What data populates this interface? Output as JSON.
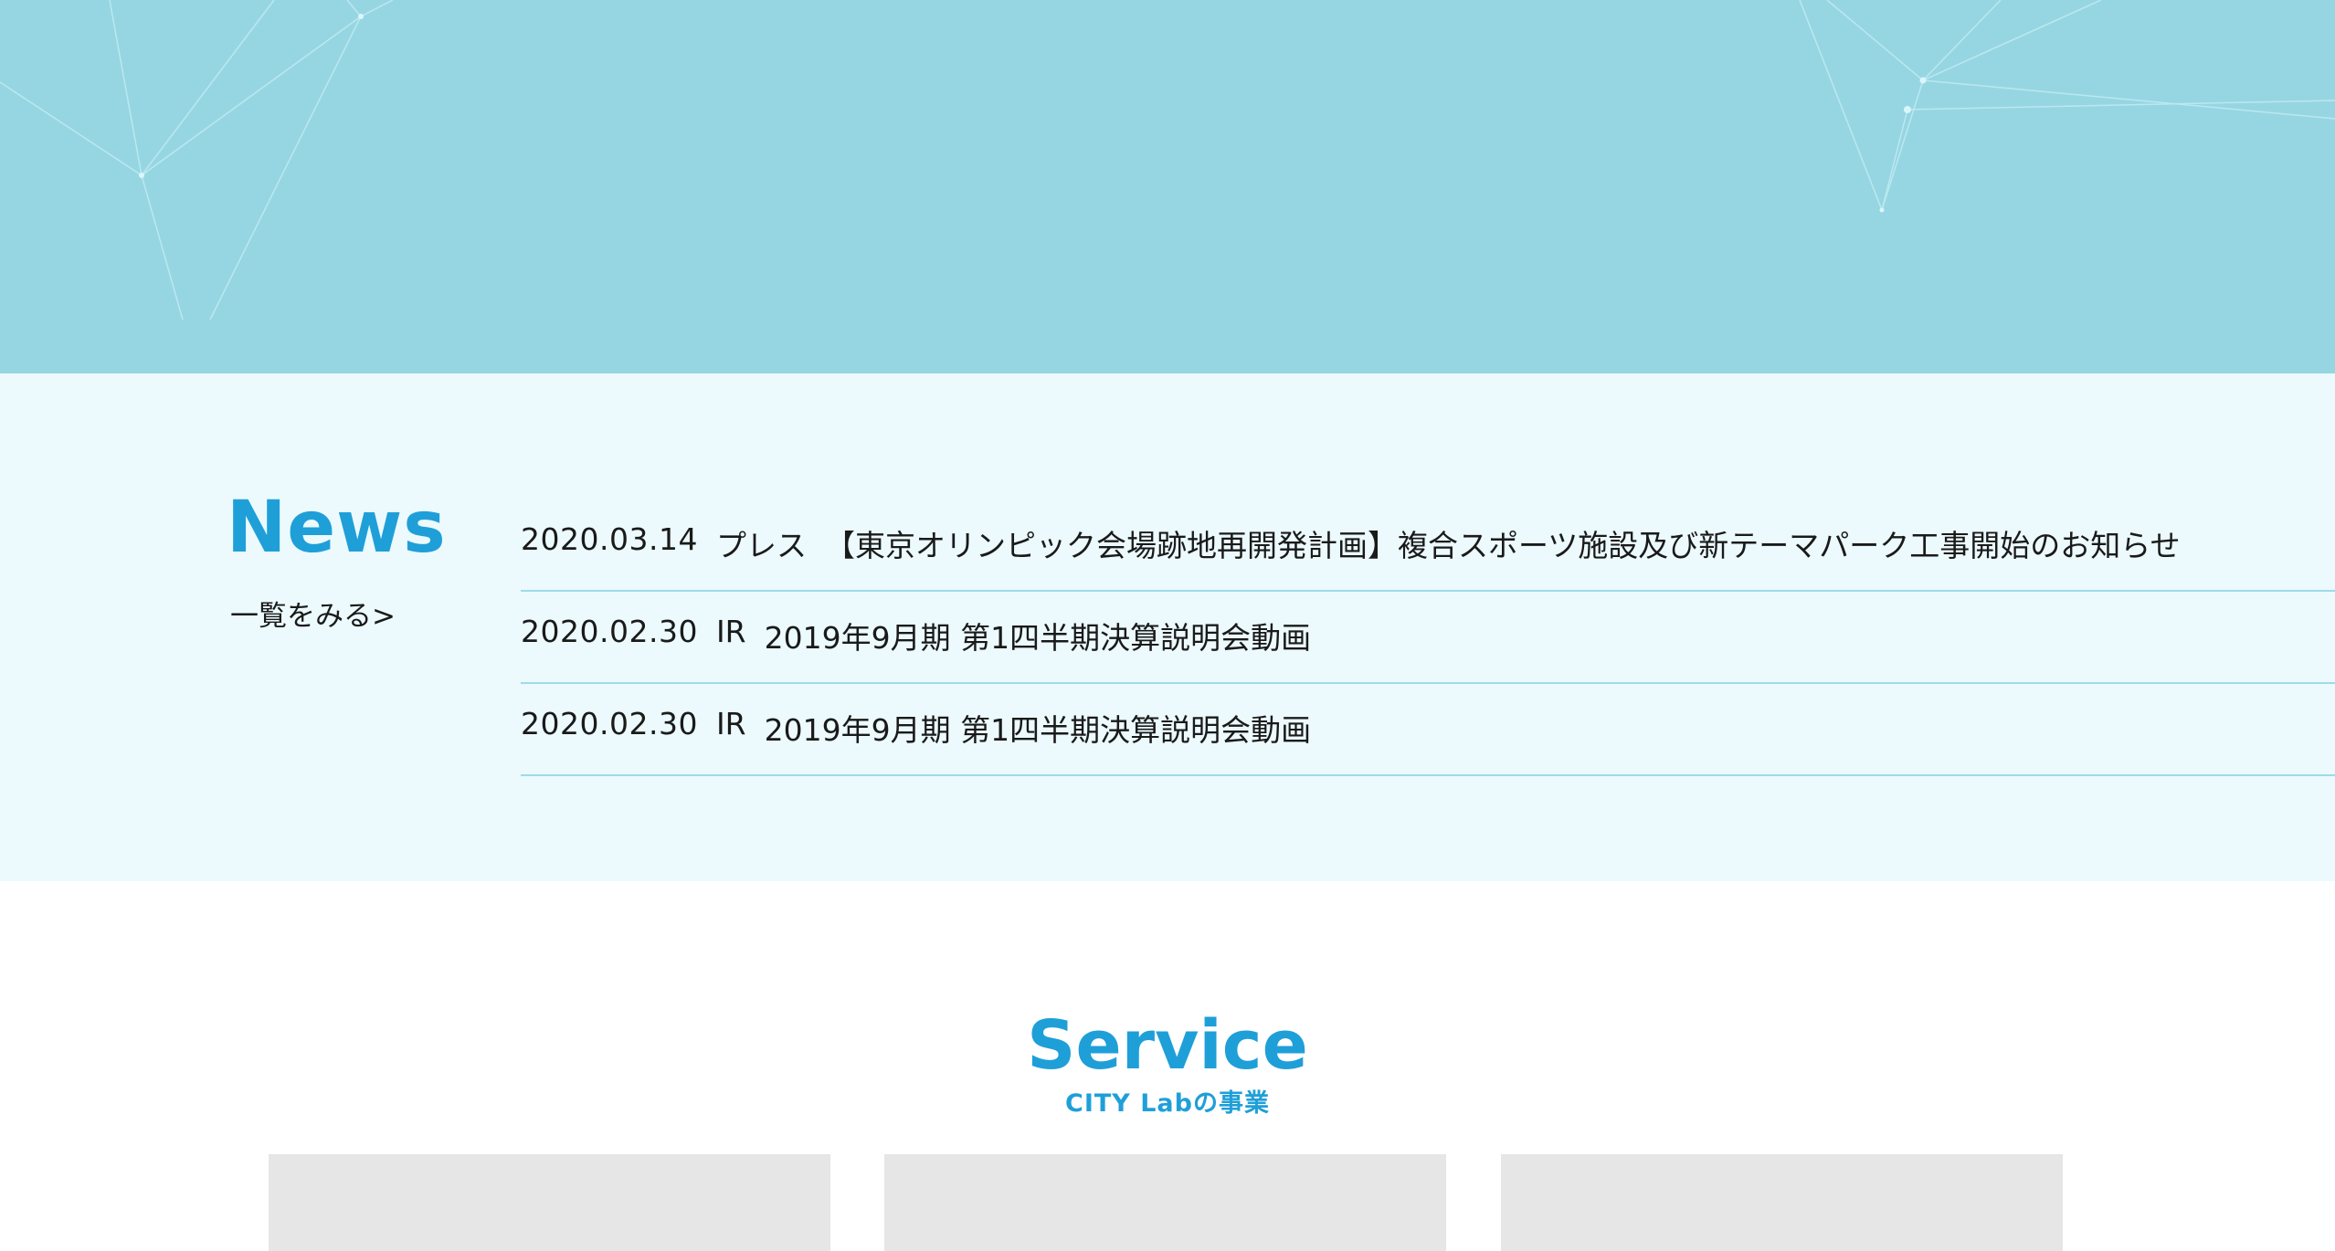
{
  "news": {
    "heading": "News",
    "more_link": "一覧をみる>",
    "items": [
      {
        "date": "2020.03.14",
        "category": "プレス",
        "title": "【東京オリンピック会場跡地再開発計画】複合スポーツ施設及び新テーマパーク工事開始のお知らせ"
      },
      {
        "date": "2020.02.30",
        "category": "IR",
        "title": "2019年9月期 第1四半期決算説明会動画"
      },
      {
        "date": "2020.02.30",
        "category": "IR",
        "title": "2019年9月期 第1四半期決算説明会動画"
      }
    ]
  },
  "service": {
    "heading": "Service",
    "subheading": "CITY Labの事業"
  },
  "colors": {
    "hero_bg": "#96d6e2",
    "news_bg": "#ecfafd",
    "accent": "#1f9fd8",
    "divider": "#9fdbe8",
    "card_bg": "#e6e6e6"
  }
}
